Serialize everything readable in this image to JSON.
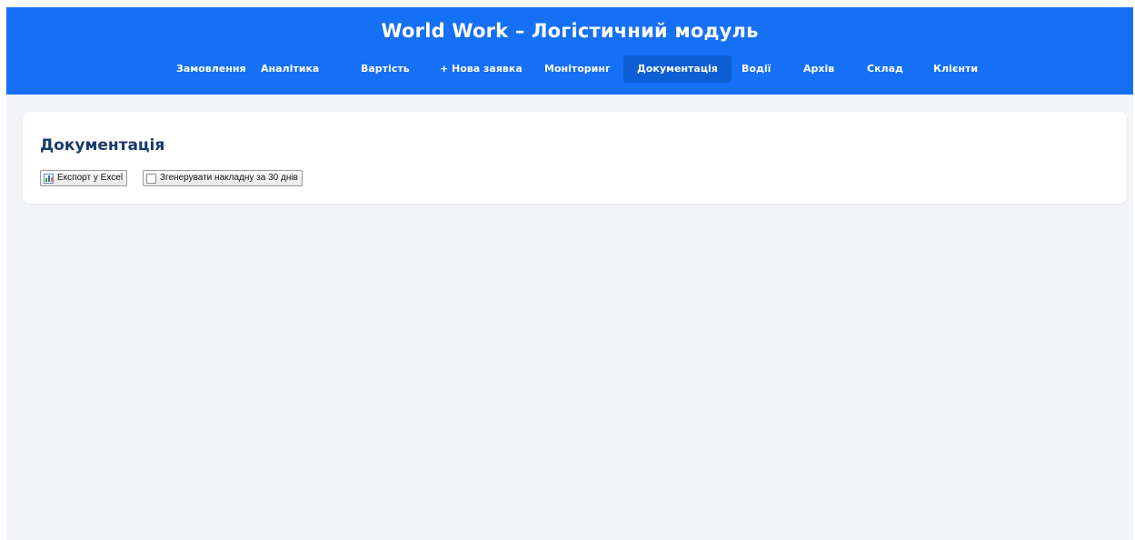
{
  "header": {
    "title": "World Work – Логістичний модуль",
    "nav": [
      {
        "label": "Замовлення",
        "active": false
      },
      {
        "label": "Аналітика",
        "active": false
      },
      {
        "label": "Вартість",
        "active": false
      },
      {
        "label": "+ Нова заявка",
        "active": false
      },
      {
        "label": "Моніторинг",
        "active": false
      },
      {
        "label": "Документація",
        "active": true
      },
      {
        "label": "Водії",
        "active": false
      },
      {
        "label": "Архів",
        "active": false
      },
      {
        "label": "Склад",
        "active": false
      },
      {
        "label": "Клієнти",
        "active": false
      }
    ]
  },
  "main": {
    "title": "Документація",
    "buttons": {
      "export_excel": {
        "label": "Експорт у Excel",
        "icon": "bar-chart-icon"
      },
      "generate_invoice": {
        "label": "Згенерувати накладну за 30 днів",
        "icon": "document-icon"
      }
    }
  },
  "colors": {
    "header_bg": "#1570f5",
    "nav_active_bg": "#0e5ed3",
    "page_bg": "#f3f5f8",
    "title_color": "#173a6b"
  }
}
